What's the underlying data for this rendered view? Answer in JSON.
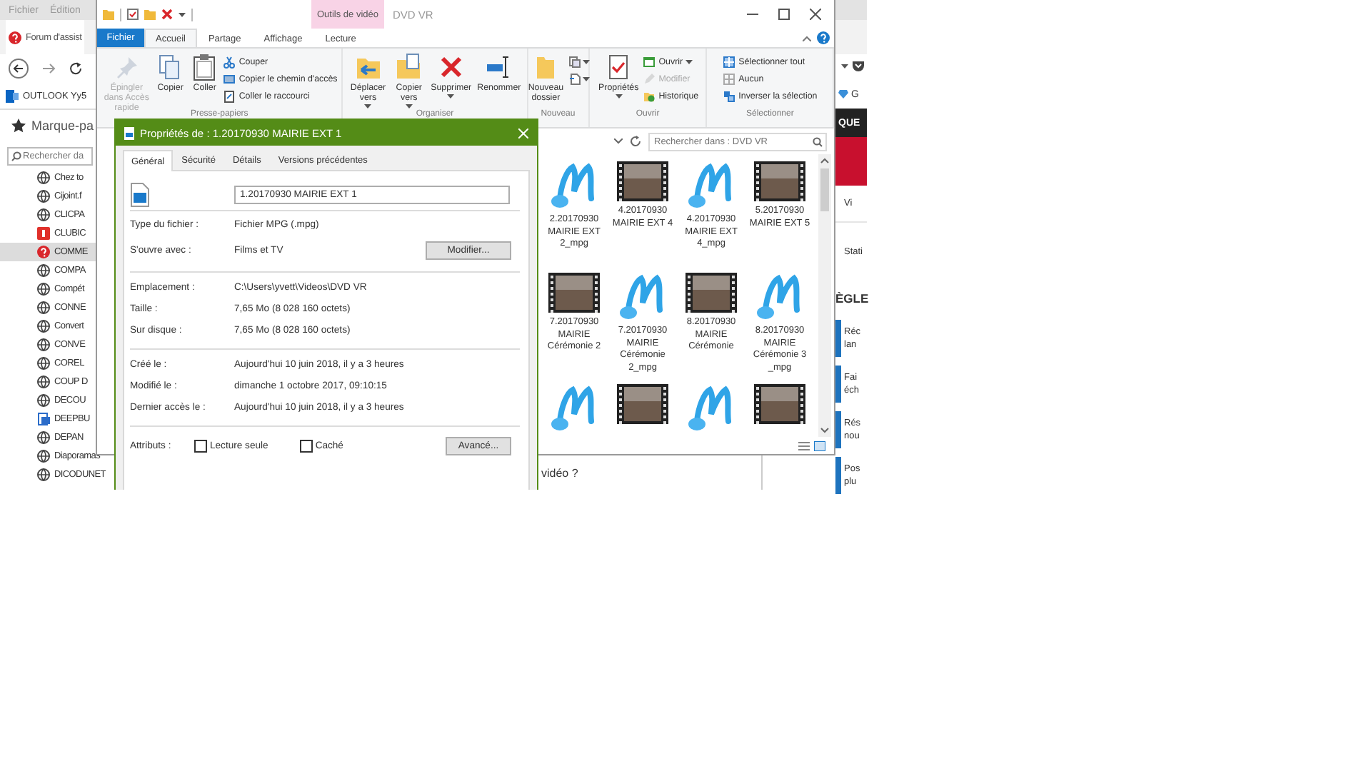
{
  "browser": {
    "menu": [
      "Fichier",
      "Édition"
    ],
    "tab": {
      "title": "Forum d'assist"
    },
    "bookmark_bar": {
      "label": "OUTLOOK Yy5"
    },
    "bookmarks": {
      "title": "Marque-pa",
      "search": {
        "placeholder": "Rechercher da"
      },
      "items": [
        {
          "label": "Chez to",
          "kind": "site",
          "selected": false
        },
        {
          "label": "Cijoint.f",
          "kind": "site",
          "selected": false
        },
        {
          "label": "CLICPA",
          "kind": "site",
          "selected": false
        },
        {
          "label": "CLUBIC",
          "kind": "clubic",
          "selected": false
        },
        {
          "label": "COMME",
          "kind": "help",
          "selected": true
        },
        {
          "label": "COMPA",
          "kind": "site",
          "selected": false
        },
        {
          "label": "Compét",
          "kind": "site",
          "selected": false
        },
        {
          "label": "CONNE",
          "kind": "site",
          "selected": false
        },
        {
          "label": "Convert",
          "kind": "site",
          "selected": false
        },
        {
          "label": "CONVE",
          "kind": "site",
          "selected": false
        },
        {
          "label": "COREL",
          "kind": "site",
          "selected": false
        },
        {
          "label": "COUP D",
          "kind": "site",
          "selected": false
        },
        {
          "label": "DECOU",
          "kind": "site",
          "selected": false
        },
        {
          "label": "DEEPBU",
          "kind": "doc",
          "selected": false
        },
        {
          "label": "DEPAN",
          "kind": "site",
          "selected": false
        },
        {
          "label": "Diaporamas",
          "kind": "site",
          "selected": false
        },
        {
          "label": "DICODUNET",
          "kind": "site",
          "selected": false
        }
      ]
    },
    "page": {
      "badge": "G",
      "banner": "QUE",
      "links": [
        "Vi",
        "Stati"
      ],
      "heading": "ÈGLE",
      "entries": [
        {
          "lines": [
            "Réc",
            "lan"
          ]
        },
        {
          "lines": [
            "Fai",
            "éch"
          ]
        },
        {
          "lines": [
            "Rés",
            "nou"
          ]
        },
        {
          "lines": [
            "Pos",
            "plu"
          ]
        }
      ],
      "question": "vidéo ?"
    }
  },
  "explorer": {
    "title": "DVD VR",
    "context_tab": "Outils de vidéo",
    "file_tab": "Fichier",
    "tabs": [
      {
        "label": "Accueil",
        "selected": true
      },
      {
        "label": "Partage",
        "selected": false
      },
      {
        "label": "Affichage",
        "selected": false
      },
      {
        "label": "Lecture",
        "selected": false
      }
    ],
    "ribbon": [
      {
        "label": "Presse-papiers",
        "commands": [
          {
            "label": "Épingler dans Accès rapide",
            "kind": "large",
            "disabled": true,
            "dropdown": false
          },
          {
            "label": "Copier",
            "kind": "large",
            "disabled": false,
            "dropdown": false
          },
          {
            "label": "Coller",
            "kind": "large",
            "disabled": false,
            "dropdown": false
          },
          {
            "label": "Couper",
            "kind": "small",
            "disabled": false,
            "dropdown": false
          },
          {
            "label": "Copier le chemin d'accès",
            "kind": "small",
            "disabled": false,
            "dropdown": false
          },
          {
            "label": "Coller le raccourci",
            "kind": "small",
            "disabled": false,
            "dropdown": false
          }
        ]
      },
      {
        "label": "Organiser",
        "commands": [
          {
            "label": "Déplacer vers",
            "kind": "large",
            "disabled": false,
            "dropdown": true
          },
          {
            "label": "Copier vers",
            "kind": "large",
            "disabled": false,
            "dropdown": true
          },
          {
            "label": "Supprimer",
            "kind": "large",
            "disabled": false,
            "dropdown": true
          },
          {
            "label": "Renommer",
            "kind": "large",
            "disabled": false,
            "dropdown": false
          }
        ]
      },
      {
        "label": "Nouveau",
        "commands": [
          {
            "label": "Nouveau dossier",
            "kind": "large",
            "disabled": false,
            "dropdown": false
          },
          {
            "kind": "icon",
            "disabled": false,
            "dropdown": true
          },
          {
            "kind": "icon",
            "disabled": false,
            "dropdown": true
          }
        ]
      },
      {
        "label": "Ouvrir",
        "commands": [
          {
            "label": "Propriétés",
            "kind": "large",
            "disabled": false,
            "dropdown": true
          },
          {
            "label": "Ouvrir",
            "kind": "small",
            "disabled": false,
            "dropdown": true
          },
          {
            "label": "Modifier",
            "kind": "small",
            "disabled": true,
            "dropdown": false
          },
          {
            "label": "Historique",
            "kind": "small",
            "disabled": false,
            "dropdown": false
          }
        ]
      },
      {
        "label": "Sélectionner",
        "commands": [
          {
            "label": "Sélectionner tout",
            "kind": "small",
            "disabled": false,
            "dropdown": false
          },
          {
            "label": "Aucun",
            "kind": "small",
            "disabled": false,
            "dropdown": false
          },
          {
            "label": "Inverser la sélection",
            "kind": "small",
            "disabled": false,
            "dropdown": false
          }
        ]
      }
    ],
    "search": {
      "placeholder": "Rechercher dans : DVD VR"
    },
    "files": [
      {
        "name": "2.20170930 MAIRIE EXT 2_mpg",
        "kind": "audio"
      },
      {
        "name": "4.20170930 MAIRIE EXT 4",
        "kind": "video"
      },
      {
        "name": "4.20170930 MAIRIE EXT 4_mpg",
        "kind": "audio"
      },
      {
        "name": "5.20170930 MAIRIE EXT 5",
        "kind": "video"
      },
      {
        "name": "7.20170930 MAIRIE Cérémonie 2",
        "kind": "video"
      },
      {
        "name": "7.20170930 MAIRIE Cérémonie 2_mpg",
        "kind": "audio"
      },
      {
        "name": "8.20170930 MAIRIE Cérémonie",
        "kind": "video"
      },
      {
        "name": "8.20170930 MAIRIE Cérémonie 3 _mpg",
        "kind": "audio"
      },
      {
        "kind": "audio"
      },
      {
        "kind": "video"
      },
      {
        "kind": "audio"
      },
      {
        "kind": "video"
      }
    ]
  },
  "dialog": {
    "title": "Propriétés de : 1.20170930 MAIRIE EXT 1",
    "tabs": [
      {
        "label": "Général",
        "selected": true
      },
      {
        "label": "Sécurité",
        "selected": false
      },
      {
        "label": "Détails",
        "selected": false
      },
      {
        "label": "Versions précédentes",
        "selected": false
      }
    ],
    "name": "1.20170930 MAIRIE EXT 1",
    "sections": [
      [
        {
          "label": "Type du fichier :",
          "value": "Fichier MPG (.mpg)"
        },
        {
          "label": "S'ouvre avec :",
          "value": "Films et TV",
          "button": "Modifier..."
        }
      ],
      [
        {
          "label": "Emplacement :",
          "value": "C:\\Users\\yvett\\Videos\\DVD VR"
        },
        {
          "label": "Taille :",
          "value": "7,65 Mo (8 028 160 octets)"
        },
        {
          "label": "Sur disque :",
          "value": "7,65 Mo (8 028 160 octets)"
        }
      ],
      [
        {
          "label": "Créé le :",
          "value": "Aujourd'hui 10 juin 2018, il y a 3 heures"
        },
        {
          "label": "Modifié le :",
          "value": "dimanche 1 octobre 2017, 09:10:15"
        },
        {
          "label": "Dernier accès le :",
          "value": "Aujourd'hui 10 juin 2018, il y a 3 heures"
        }
      ]
    ],
    "attributes": {
      "label": "Attributs :",
      "options": [
        {
          "label": "Lecture seule",
          "checked": false
        },
        {
          "label": "Caché",
          "checked": false
        }
      ],
      "button": "Avancé..."
    }
  }
}
